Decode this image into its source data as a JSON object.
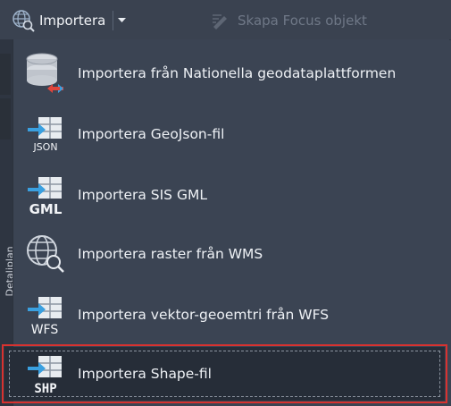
{
  "toolbar": {
    "import_dropdown_label": "Importera",
    "focus_button_label": "Skapa Focus objekt"
  },
  "side_panel": {
    "vertical_label": "Detaljplan"
  },
  "menu": {
    "items": [
      {
        "label": "Importera från Nationella geodataplattformen",
        "icon": "database-export-icon"
      },
      {
        "label": "Importera GeoJson-fil",
        "icon": "json-import-icon",
        "badge": "JSON"
      },
      {
        "label": "Importera SIS GML",
        "icon": "gml-import-icon",
        "badge": "GML"
      },
      {
        "label": "Importera raster från WMS",
        "icon": "globe-search-icon"
      },
      {
        "label": "Importera vektor-geoemtri från WFS",
        "icon": "wfs-import-icon",
        "badge": "WFS"
      },
      {
        "label": "Importera Shape-fil",
        "icon": "shp-import-icon",
        "badge": "SHP",
        "selected": true
      }
    ]
  },
  "colors": {
    "background": "#3b4453",
    "highlight_border": "#d8322f",
    "selected_bg": "#262d38",
    "accent_blue": "#3aa0e0"
  }
}
